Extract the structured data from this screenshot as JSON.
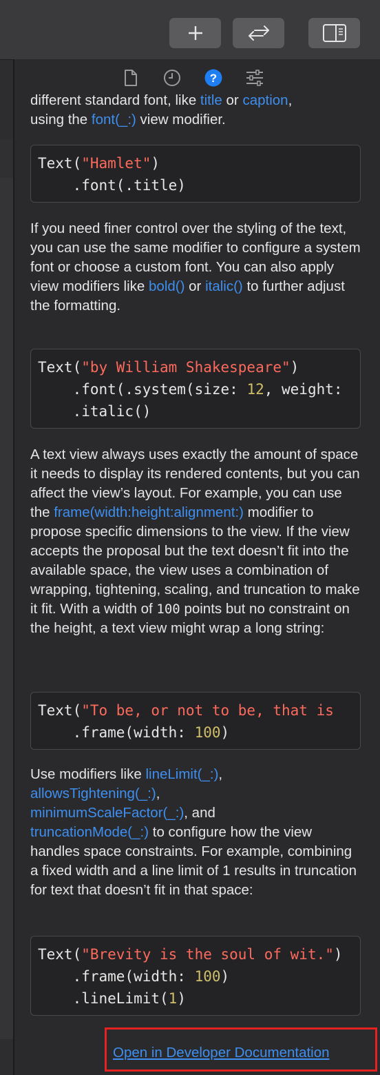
{
  "toolbar": {
    "add_button_icon": "plus-icon",
    "swap_button_icon": "swap-arrows-icon",
    "inspector_toggle_icon": "right-panel-icon"
  },
  "inspector_tabs": [
    {
      "icon": "file-icon",
      "active": false
    },
    {
      "icon": "clock-icon",
      "active": false
    },
    {
      "icon": "help-icon",
      "active": true
    },
    {
      "icon": "sliders-icon",
      "active": false
    }
  ],
  "colors": {
    "link": "#3e8ff0",
    "string": "#fc6a5d",
    "number": "#d0bf69",
    "text": "#e5e5e7",
    "highlight": "#e52222"
  },
  "doc": {
    "p0_a": "different standard font, like ",
    "p0_link1": "title",
    "p0_b": " or ",
    "p0_link2": "caption",
    "p0_c": ",",
    "p0_d": "using the ",
    "p0_link3": "font(_:)",
    "p0_e": " view modifier.",
    "code1_l1_a": "Text(",
    "code1_l1_str": "\"Hamlet\"",
    "code1_l1_b": ")",
    "code1_l2": "    .font(.title)",
    "p1_a": "If you need finer control over the styling of the text, you can use the same modifier to configure a system font or choose a custom font. You can also apply view modifiers like ",
    "p1_link1": "bold()",
    "p1_b": " or ",
    "p1_link2": "italic()",
    "p1_c": " to further adjust the formatting.",
    "code2_l1_a": "Text(",
    "code2_l1_str": "\"by William Shakespeare\"",
    "code2_l1_b": ")",
    "code2_l2_a": "    .font(.system(size: ",
    "code2_l2_num": "12",
    "code2_l2_b": ", weight:",
    "code2_l3": "    .italic()",
    "p2_a": "A text view always uses exactly the amount of space it needs to display its rendered contents, but you can affect the view’s layout. For example, you can use the ",
    "p2_link1": "frame(width:height:alignment:)",
    "p2_b": " modifier to propose specific dimensions to the view. If the view accepts the proposal but the text doesn’t fit into the available space, the view uses a combination of wrapping, tightening, scaling, and truncation to make it fit. With a width of ",
    "p2_mono": "100",
    "p2_c": " points but no constraint on the height, a text view might wrap a long string:",
    "code3_l1_a": "Text(",
    "code3_l1_str": "\"To be, or not to be, that is",
    "code3_l2_a": "    .frame(width: ",
    "code3_l2_num": "100",
    "code3_l2_b": ")",
    "p3_a": "Use modifiers like ",
    "p3_link1": "lineLimit(_:)",
    "p3_b": ",",
    "p3_link2": "allowsTightening(_:)",
    "p3_c": ",",
    "p3_link3": "minimumScaleFactor(_:)",
    "p3_d": ", and",
    "p3_link4": "truncationMode(_:)",
    "p3_e": " to configure how the view handles space constraints. For example, combining a fixed width and a line limit of 1 results in truncation for text that doesn’t fit in that space:",
    "code4_l1_a": "Text(",
    "code4_l1_str": "\"Brevity is the soul of wit.\"",
    "code4_l1_b": ")",
    "code4_l2_a": "    .frame(width: ",
    "code4_l2_num": "100",
    "code4_l2_b": ")",
    "code4_l3_a": "    .lineLimit(",
    "code4_l3_num": "1",
    "code4_l3_b": ")"
  },
  "footer": {
    "open_docs_link": "Open in Developer Documentation"
  }
}
